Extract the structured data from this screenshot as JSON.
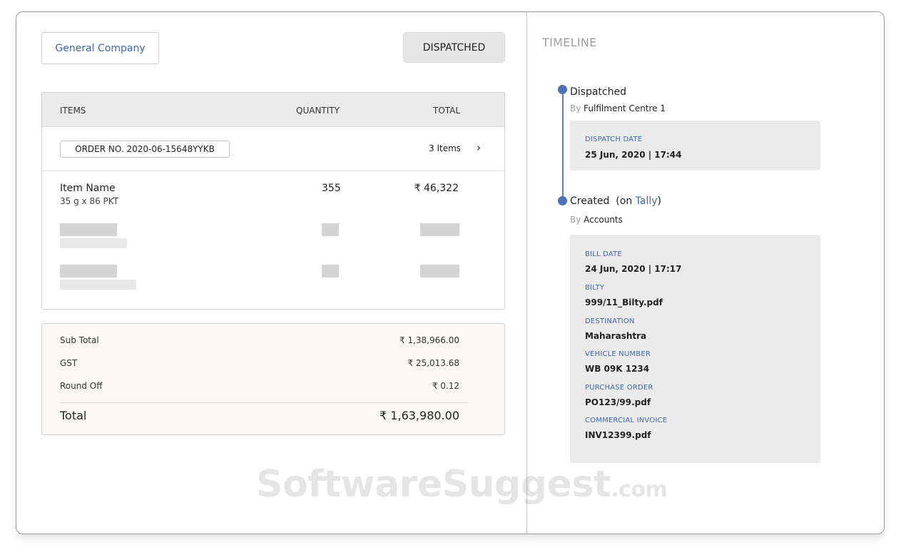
{
  "header": {
    "company_label": "General Company",
    "status_label": "DISPATCHED"
  },
  "items_table": {
    "col_items": "ITEMS",
    "col_quantity": "QUANTITY",
    "col_total": "TOTAL",
    "order_number": "ORDER NO. 2020-06-15648YYKB",
    "items_count": "3 Items",
    "chevron_glyph": "›",
    "rows": [
      {
        "name": "Item Name",
        "desc": "35 g x 86 PKT",
        "quantity": "355",
        "total": "₹ 46,322"
      }
    ]
  },
  "totals": {
    "subtotal_label": "Sub Total",
    "subtotal_value": "₹ 1,38,966.00",
    "gst_label": "GST",
    "gst_value": "₹ 25,013.68",
    "roundoff_label": "Round Off",
    "roundoff_value": "₹ 0.12",
    "total_label": "Total",
    "total_value": "₹ 1,63,980.00"
  },
  "timeline": {
    "title": "TIMELINE",
    "events": [
      {
        "title": "Dispatched",
        "by_prefix": "By",
        "by_value": "Fulfilment Centre 1",
        "details": [
          {
            "label": "DISPATCH DATE",
            "value": "25 Jun, 2020 | 17:44"
          }
        ]
      },
      {
        "title_prefix": "Created  (on ",
        "title_link": "Tally",
        "title_suffix": ")",
        "by_prefix": "By",
        "by_value": "Accounts",
        "details": [
          {
            "label": "BILL DATE",
            "value": "24 Jun, 2020 | 17:17"
          },
          {
            "label": "BILTY",
            "value": "999/11_Bilty.pdf"
          },
          {
            "label": "DESTINATION",
            "value": "Maharashtra"
          },
          {
            "label": "VEHICLE NUMBER",
            "value": "WB 09K 1234"
          },
          {
            "label": "PURCHASE ORDER",
            "value": "PO123/99.pdf"
          },
          {
            "label": "COMMERCIAL INVOICE",
            "value": "INV12399.pdf"
          }
        ]
      }
    ]
  },
  "watermark": {
    "main": "SoftwareSuggest",
    "tld": ".com"
  },
  "colors": {
    "accent_blue": "#3f67a8",
    "timeline_blue": "#4d72b8",
    "totals_bg": "#f9f8f3",
    "detail_bg": "#ebebeb"
  }
}
